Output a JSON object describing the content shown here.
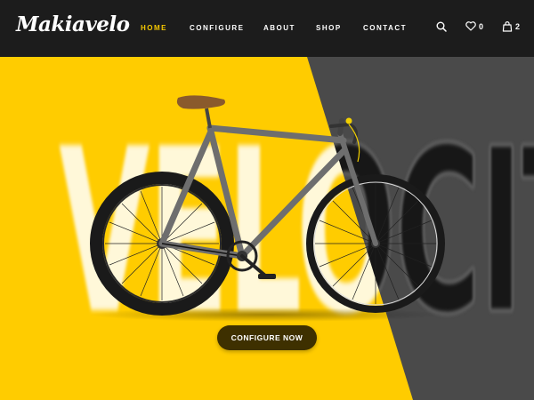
{
  "brand": {
    "logo_text": "Makiavelo"
  },
  "nav": {
    "items": [
      {
        "label": "HOME",
        "active": true
      },
      {
        "label": "CONFIGURE"
      },
      {
        "label": "ABOUT"
      },
      {
        "label": "SHOP"
      },
      {
        "label": "CONTACT"
      }
    ]
  },
  "header_icons": {
    "search": {
      "icon": "search-icon"
    },
    "favorites": {
      "icon": "heart-icon",
      "count": "0"
    },
    "cart": {
      "icon": "shopping-bag-icon",
      "count": "2"
    }
  },
  "hero": {
    "background_word": "VELOCITY",
    "cta_label": "CONFIGURE NOW"
  },
  "colors": {
    "header_bg": "#1c1c1c",
    "accent": "#f6c800",
    "hero_yellow": "#ffcc00",
    "hero_dark": "#4a4a4a",
    "cta_bg": "#3e3000"
  }
}
